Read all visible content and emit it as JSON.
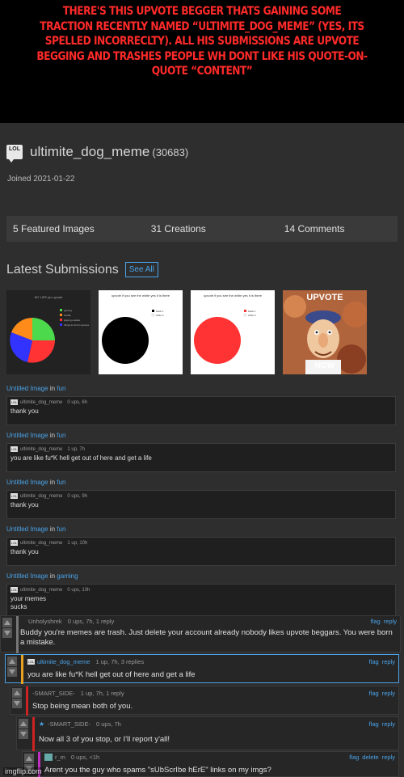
{
  "caption": "There's this upvote begger thats gaining some traction recently named “ultimite_dog_meme” (yes, its spelled incorreclty). All his submissions are upvote begging and trashes people wh dont like his quote-on-quote “content”",
  "profile": {
    "badge": "LOL",
    "username": "ultimite_dog_meme",
    "points": "(30683)",
    "joined": "Joined 2021-01-22"
  },
  "stats": [
    "5 Featured Images",
    "31 Creations",
    "14 Comments"
  ],
  "latest": {
    "title": "Latest Submissions",
    "see_all": "See All"
  },
  "thumbnails": [
    {
      "title": "MY LIFE plz upvote",
      "legend": [
        "gaming",
        "fun/life",
        "playing outside",
        "things to do for upvotes"
      ],
      "colors": [
        "#4cd94c",
        "#ff8c1a",
        "#ff3333",
        "#3333ff"
      ]
    },
    {
      "title": "upvote if you see the white yes it is there",
      "legend": [
        "black 1",
        "white 2"
      ],
      "color": "#000000"
    },
    {
      "title": "upvote if you see the white yes it is there",
      "legend": [
        "black 1",
        "white 2"
      ],
      "color": "#ff3333"
    },
    {
      "caption_top": "UPVOTE",
      "caption_bottom": "NOW"
    }
  ],
  "entries": [
    {
      "link": "Untitled Image",
      "in": "in",
      "stream": "fun",
      "user": "ultimite_dog_meme",
      "meta": "0 ups, 6h",
      "text": "thank you"
    },
    {
      "link": "Untitled Image",
      "in": "in",
      "stream": "fun",
      "user": "ultimite_dog_meme",
      "meta": "1 up, 7h",
      "text": "you are like fu*K hell get out of here and get a life"
    },
    {
      "link": "Untitled Image",
      "in": "in",
      "stream": "fun",
      "user": "ultimite_dog_meme",
      "meta": "0 ups, 9h",
      "text": "thank you"
    },
    {
      "link": "Untitled Image",
      "in": "in",
      "stream": "fun",
      "user": "ultimite_dog_meme",
      "meta": "1 up, 10h",
      "text": "thank you"
    },
    {
      "link": "Untitled Image",
      "in": "in",
      "stream": "gaming",
      "user": "ultimite_dog_meme",
      "meta": "0 ups, 10h",
      "text": "your memes sucks"
    }
  ],
  "thread": [
    {
      "user": "Unholyshrek",
      "meta": "0 ups, 7h, 1 reply",
      "text": "Buddy you're memes are trash. Just delete your account already nobody likes upvote beggars. You were born a mistake.",
      "actions": [
        "flag",
        "reply"
      ],
      "stripe": "#777777"
    },
    {
      "user": "ultimite_dog_meme",
      "meta": "1 up, 7h, 3 replies",
      "text": "you are like fu*K hell get out of here and get a life",
      "actions": [
        "flag",
        "reply"
      ],
      "stripe": "#e8a020"
    },
    {
      "user": "-SMART_SIDE-",
      "meta": "1 up, 7h, 1 reply",
      "text": "Stop being mean both of you.",
      "actions": [
        "flag",
        "reply"
      ],
      "stripe": "#cc2222"
    },
    {
      "user": "-SMART_SIDE-",
      "meta": "0 ups, 7h",
      "text": "Now all 3 of you stop, or I'll report y'all!",
      "actions": [
        "flag",
        "reply"
      ],
      "stripe": "#cc2222"
    },
    {
      "user": "r_m",
      "meta": "0 ups, <1h",
      "text": "Arent you the guy who spams \"sUbScrIbe hErE\" links on my imgs?",
      "actions": [
        "flag",
        "delete",
        "reply"
      ],
      "stripe": "#c030c0"
    }
  ],
  "watermark": "imgflip.com"
}
